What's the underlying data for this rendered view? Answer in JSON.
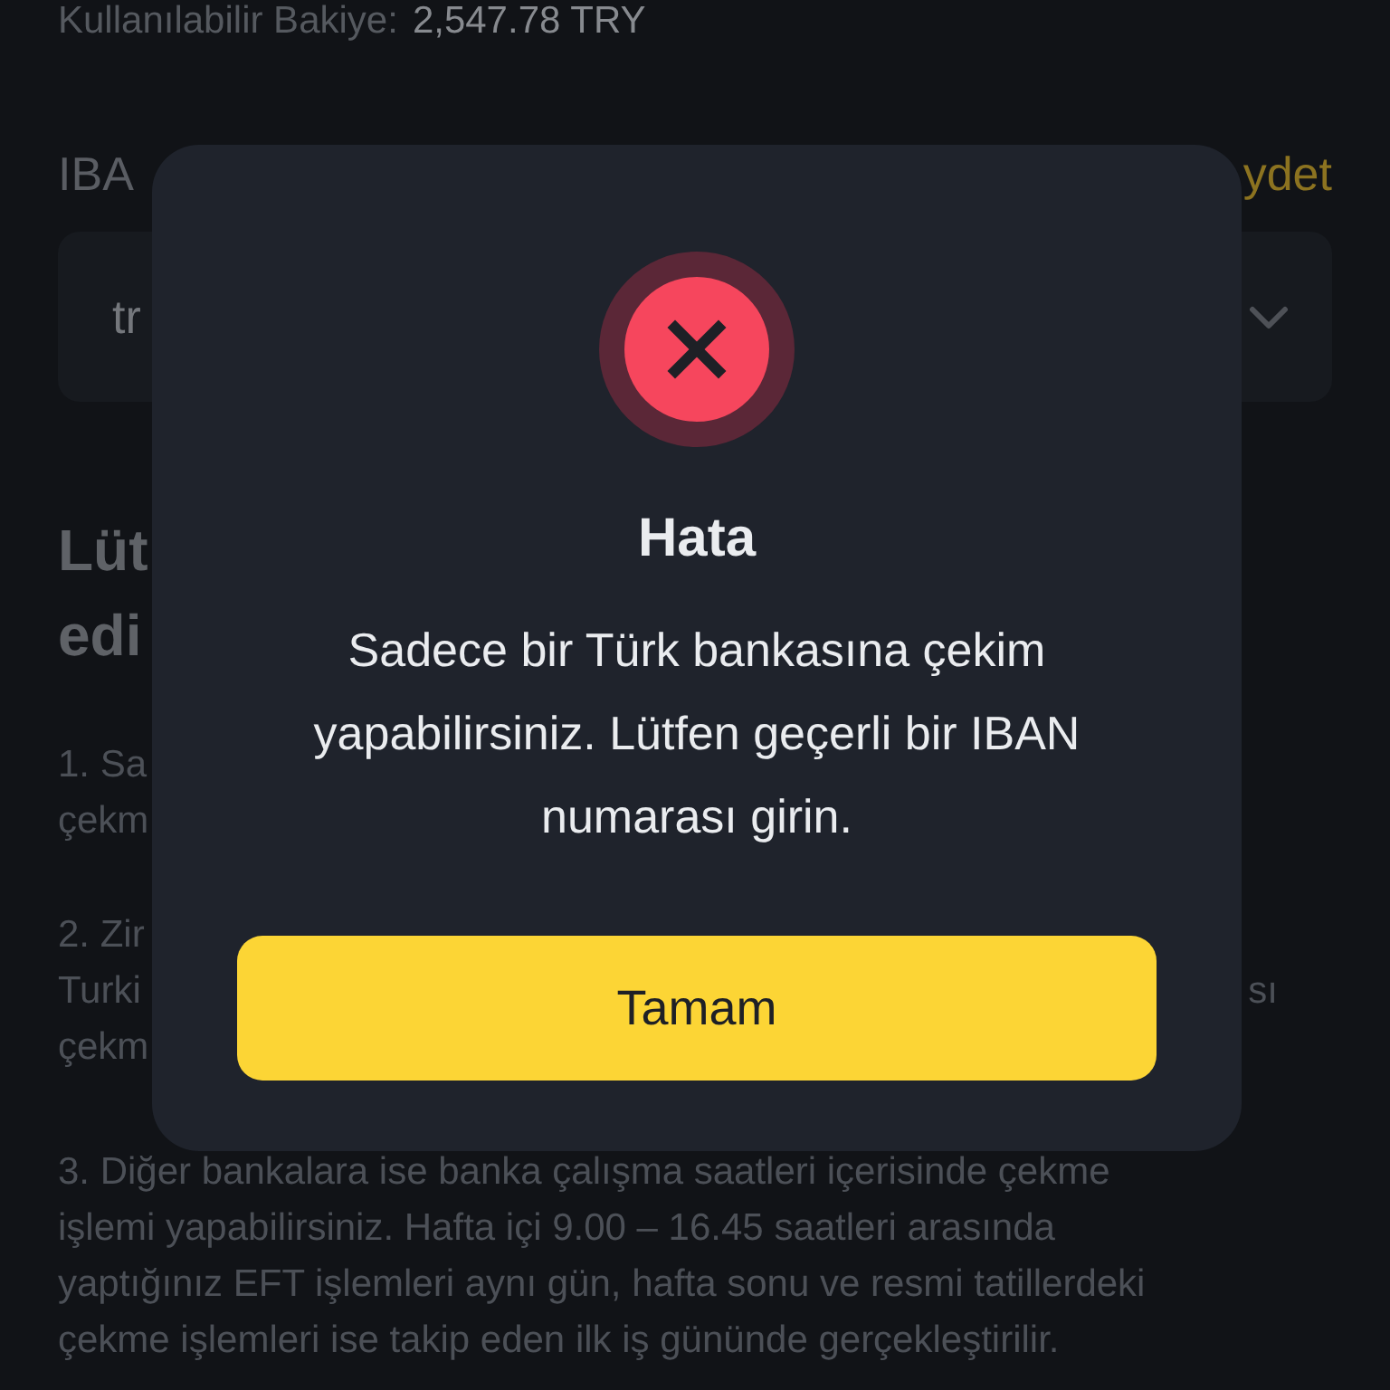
{
  "balance": {
    "label": "Kullanılabilir Bakiye:",
    "value": "2,547.78 TRY"
  },
  "iban": {
    "label": "IBA",
    "action": "ydet",
    "field": {
      "value": "tr"
    }
  },
  "heading": [
    "Lüt",
    "edi"
  ],
  "notes": [
    {
      "kind": "fragments",
      "lines": [
        {
          "text": "1. Sa"
        },
        {
          "text": "çekm"
        }
      ]
    },
    {
      "kind": "fragments",
      "lines": [
        {
          "text": "2. Zir"
        },
        {
          "text": "Turki",
          "end": "sı"
        },
        {
          "text": "çekm"
        }
      ]
    },
    {
      "kind": "paragraph",
      "text": "3. Diğer bankalara ise banka çalışma saatleri içerisinde çekme işlemi yapabilirsiniz. Hafta içi 9.00 – 16.45 saatleri arasında yaptığınız EFT işlemleri aynı gün, hafta sonu ve resmi tatillerdeki çekme işlemleri ise takip eden ilk iş gününde gerçekleştirilir."
    }
  ],
  "dialog": {
    "title": "Hata",
    "message": "Sadece bir Türk bankasına çekim yapabilirsiniz. Lütfen geçerli bir IBAN numarası girin.",
    "button": "Tamam"
  }
}
